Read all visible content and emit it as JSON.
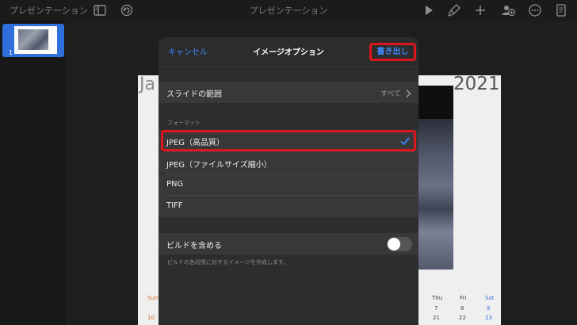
{
  "toolbar": {
    "left_title": "プレゼンテーション",
    "center_title": "プレゼンテーション"
  },
  "navigator": {
    "slide_number": "1"
  },
  "slide": {
    "month_fragment": "Ja",
    "year": "2021",
    "calendar": {
      "sun_label": "Sun",
      "thu_label": "Thu",
      "fri_label": "Fri",
      "sat_label": "Sat",
      "row1": [
        "7",
        "8",
        "9"
      ],
      "row2_sun": "10",
      "row2": [
        "21",
        "22",
        "23"
      ]
    }
  },
  "popover": {
    "cancel_label": "キャンセル",
    "title": "イメージオプション",
    "export_label": "書き出し",
    "range_label": "スライドの範囲",
    "range_value": "すべて",
    "format_header": "フォーマット",
    "formats": [
      {
        "label": "JPEG（高品質）",
        "selected": true
      },
      {
        "label": "JPEG（ファイルサイズ縮小）",
        "selected": false
      },
      {
        "label": "PNG",
        "selected": false
      },
      {
        "label": "TIFF",
        "selected": false
      }
    ],
    "builds_label": "ビルドを含める",
    "builds_on": false,
    "builds_note": "ビルドの各段階に対するイメージを作成します。"
  },
  "colors": {
    "accent": "#3d84f6",
    "highlight": "#e0141c"
  }
}
